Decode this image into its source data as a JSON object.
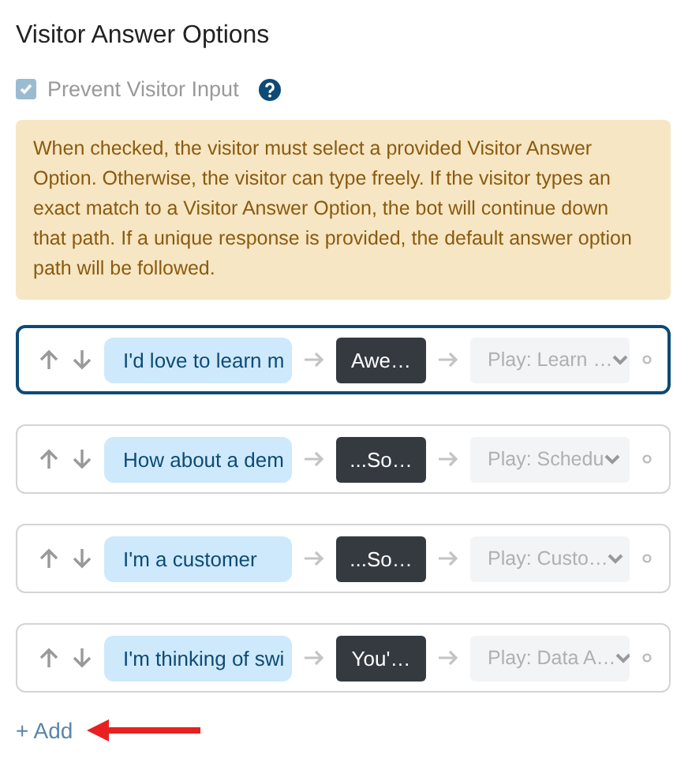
{
  "title": "Visitor Answer Options",
  "prevent_input": {
    "label": "Prevent Visitor Input",
    "checked": true
  },
  "note": "When checked, the visitor must select a provided Visitor Answer Option. Otherwise, the visitor can type freely. If the visitor types an exact match to a Visitor Answer Option, the bot will continue down that path. If a unique response is provided, the default answer option path will be followed.",
  "options": [
    {
      "answer": "I'd love to learn m",
      "reply": "Awe…",
      "play": "Play: Learn …",
      "selected": true
    },
    {
      "answer": "How about a dem",
      "reply": "...So…",
      "play": "Play: Schedu",
      "selected": false
    },
    {
      "answer": "I'm a customer",
      "reply": "...So…",
      "play": "Play: Custo…",
      "selected": false
    },
    {
      "answer": "I'm thinking of swi",
      "reply": "You'…",
      "play": "Play: Data A…",
      "selected": false
    }
  ],
  "add_label": "+ Add"
}
